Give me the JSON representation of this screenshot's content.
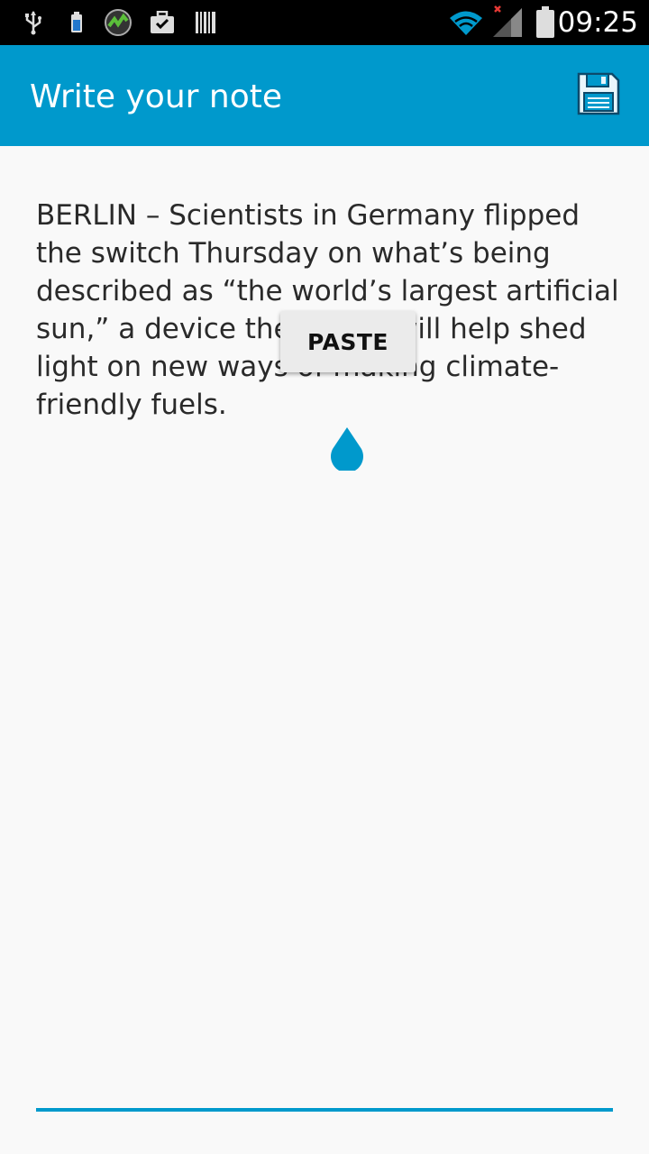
{
  "status_bar": {
    "time": "09:25",
    "left_icons": [
      "usb-icon",
      "battery-small-icon",
      "app-gauge-icon",
      "briefcase-check-icon",
      "barcode-icon"
    ],
    "right_icons": [
      "wifi-icon",
      "signal-icon",
      "battery-icon"
    ]
  },
  "app_bar": {
    "title": "Write your note",
    "action_icon": "save-icon",
    "color": "#0099cc"
  },
  "editor": {
    "text": "BERLIN – Scientists in Germany flipped the switch Thursday on what’s being described as “the world’s largest artificial sun,” a device they hope will help shed light on new ways of making climate-friendly fuels.",
    "underline_color": "#0099cc"
  },
  "context_popup": {
    "paste_label": "PASTE"
  }
}
